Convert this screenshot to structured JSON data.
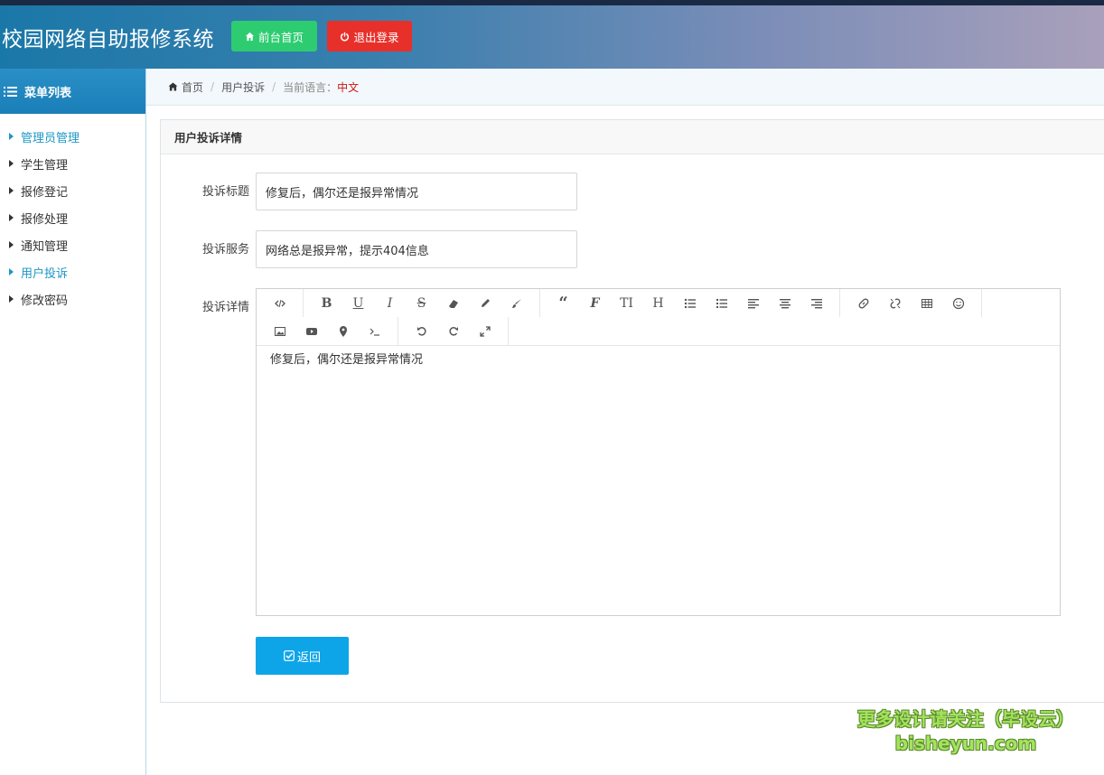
{
  "header": {
    "app_title": "校园网络自助报修系统",
    "home_button": "前台首页",
    "logout_button": "退出登录"
  },
  "sidebar": {
    "title": "菜单列表",
    "items": [
      {
        "label": "管理员管理",
        "active": true
      },
      {
        "label": "学生管理",
        "active": false
      },
      {
        "label": "报修登记",
        "active": false
      },
      {
        "label": "报修处理",
        "active": false
      },
      {
        "label": "通知管理",
        "active": false
      },
      {
        "label": "用户投诉",
        "active": true
      },
      {
        "label": "修改密码",
        "active": false
      }
    ]
  },
  "breadcrumb": {
    "home": "首页",
    "current": "用户投诉",
    "lang_label": "当前语言：",
    "lang_value": "中文"
  },
  "panel": {
    "title": "用户投诉详情",
    "fields": {
      "title_label": "投诉标题",
      "title_value": "修复后，偶尔还是报异常情况",
      "service_label": "投诉服务",
      "service_value": "网络总是报异常，提示404信息",
      "detail_label": "投诉详情",
      "detail_value": "修复后，偶尔还是报异常情况"
    },
    "back_button": "返回"
  },
  "watermark": {
    "line1": "更多设计请关注（毕设云）",
    "line2": "bisheyun.com"
  },
  "colors": {
    "accent": "#1d97c6",
    "home_btn": "#2ecc71",
    "logout_btn": "#e8302b",
    "back_btn": "#0ea5e8",
    "lang_value": "#d01515"
  }
}
